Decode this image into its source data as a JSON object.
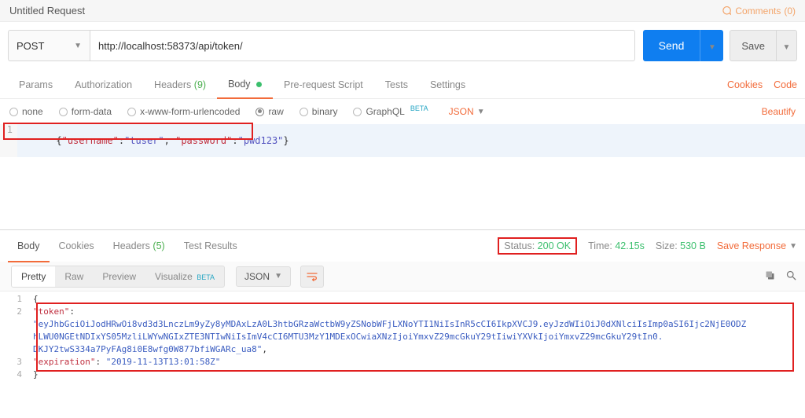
{
  "title": "Untitled Request",
  "comments": {
    "label": "Comments",
    "count": "(0)"
  },
  "request": {
    "method": "POST",
    "url": "http://localhost:58373/api/token/",
    "send": "Send",
    "save": "Save"
  },
  "tabs": {
    "params": "Params",
    "authorization": "Authorization",
    "headers": "Headers",
    "headers_count": "(9)",
    "body": "Body",
    "prerequest": "Pre-request Script",
    "tests": "Tests",
    "settings": "Settings",
    "cookies": "Cookies",
    "code": "Code"
  },
  "body_types": {
    "none": "none",
    "form_data": "form-data",
    "xwww": "x-www-form-urlencoded",
    "raw": "raw",
    "binary": "binary",
    "graphql": "GraphQL",
    "beta": "BETA",
    "json": "JSON",
    "beautify": "Beautify"
  },
  "body_editor": {
    "line_no": "1",
    "brace_open": "{",
    "k_username": "\"username\"",
    "v_username": "\"tuser\"",
    "k_password": "\"password\"",
    "v_password": "\"pwd123\"",
    "brace_close": "}",
    "colon": ":",
    "comma": ", "
  },
  "response_tabs": {
    "body": "Body",
    "cookies": "Cookies",
    "headers": "Headers",
    "headers_count": "(5)",
    "tests": "Test Results"
  },
  "response_meta": {
    "status_label": "Status:",
    "status_value": "200 OK",
    "time_label": "Time:",
    "time_value": "42.15s",
    "size_label": "Size:",
    "size_value": "530 B",
    "save_response": "Save Response"
  },
  "view": {
    "pretty": "Pretty",
    "raw": "Raw",
    "preview": "Preview",
    "visualize": "Visualize",
    "beta": "BETA",
    "json": "JSON"
  },
  "response_body": {
    "l1": "1",
    "l2": "2",
    "l3": "3",
    "l4": "4",
    "brace_open": "{",
    "brace_close": "}",
    "token_key": "\"token\"",
    "colon": ":",
    "token_seg1": "\"eyJhbGciOiJodHRwOi8vd3d3LnczLm9yZy8yMDAxLzA0L3htbGRzaWctbW9yZSNobWFjLXNoYTI1NiIsInR5cCI6IkpXVCJ9.eyJzdWIiOiJ0dXNlciIsImp0aSI6Ijc2NjE0ODZ",
    "token_seg2": "hLWU0NGEtNDIxYS05MzliLWYwNGIxZTE3NTIwNiIsImV4cCI6MTU3MzY1MDExOCwiaXNzIjoiYmxvZ29mcGkuY29tIiwiYXVkIjoiYmxvZ29mcGkuY29tIn0.",
    "token_seg3": "DKJY2twS334a7PyFAg8i0E8wfg0W877bfiWGARc_ua8\"",
    "expiration_key": "\"expiration\"",
    "expiration_val": "\"2019-11-13T13:01:58Z\"",
    "comma": ","
  }
}
